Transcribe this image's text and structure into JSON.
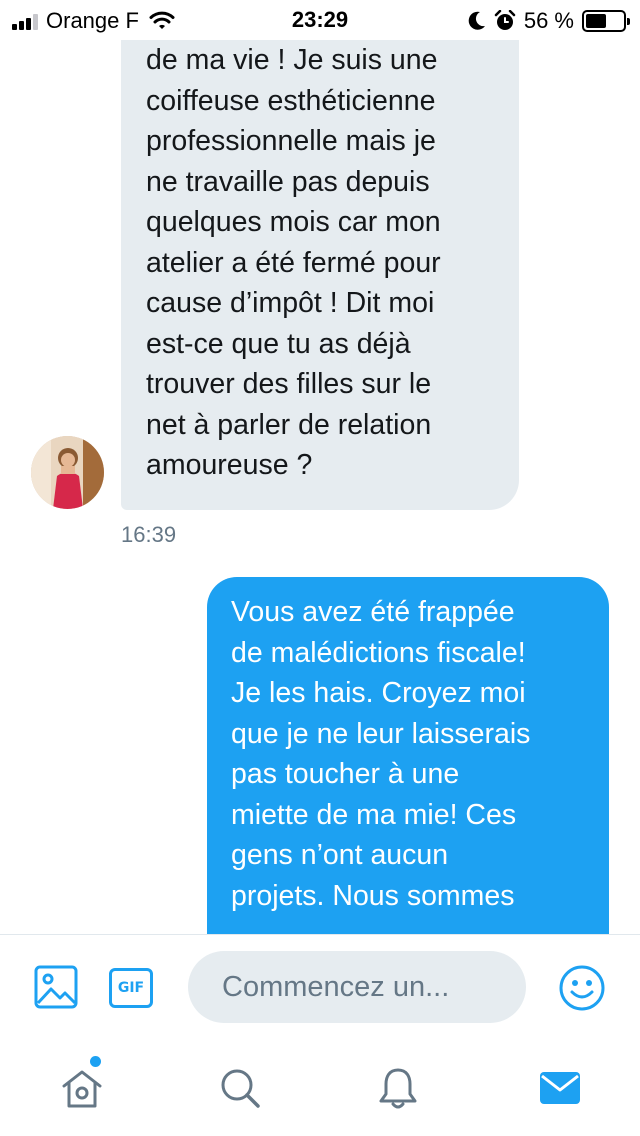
{
  "status_bar": {
    "carrier": "Orange F",
    "time": "23:29",
    "battery_percent": "56 %",
    "battery_level": 0.56,
    "signal_bars": 3
  },
  "conversation": {
    "incoming": {
      "lines": [
        "de ma vie ! Je suis une",
        "coiffeuse esthéticienne",
        "professionnelle mais je",
        "ne travaille pas depuis",
        "quelques mois car mon",
        "atelier a été fermé pour",
        "cause d’impôt ! Dit moi",
        "est-ce que tu as déjà",
        "trouver des filles sur le",
        "net à parler de relation",
        "amoureuse ?"
      ],
      "timestamp": "16:39"
    },
    "outgoing": {
      "lines": [
        "Vous avez été frappée",
        "de malédictions fiscale!",
        "Je les hais. Croyez moi",
        "que je ne leur laisserais",
        "pas toucher à une",
        "miette de ma mie! Ces",
        "gens n’ont aucun",
        "projets. Nous sommes"
      ]
    }
  },
  "composer": {
    "placeholder": "Commencez un...",
    "gif_label": "GIF"
  },
  "colors": {
    "accent": "#1da1f2",
    "incoming_bubble": "#e6ecf0",
    "secondary_text": "#657786",
    "icon_gray": "#657786"
  }
}
